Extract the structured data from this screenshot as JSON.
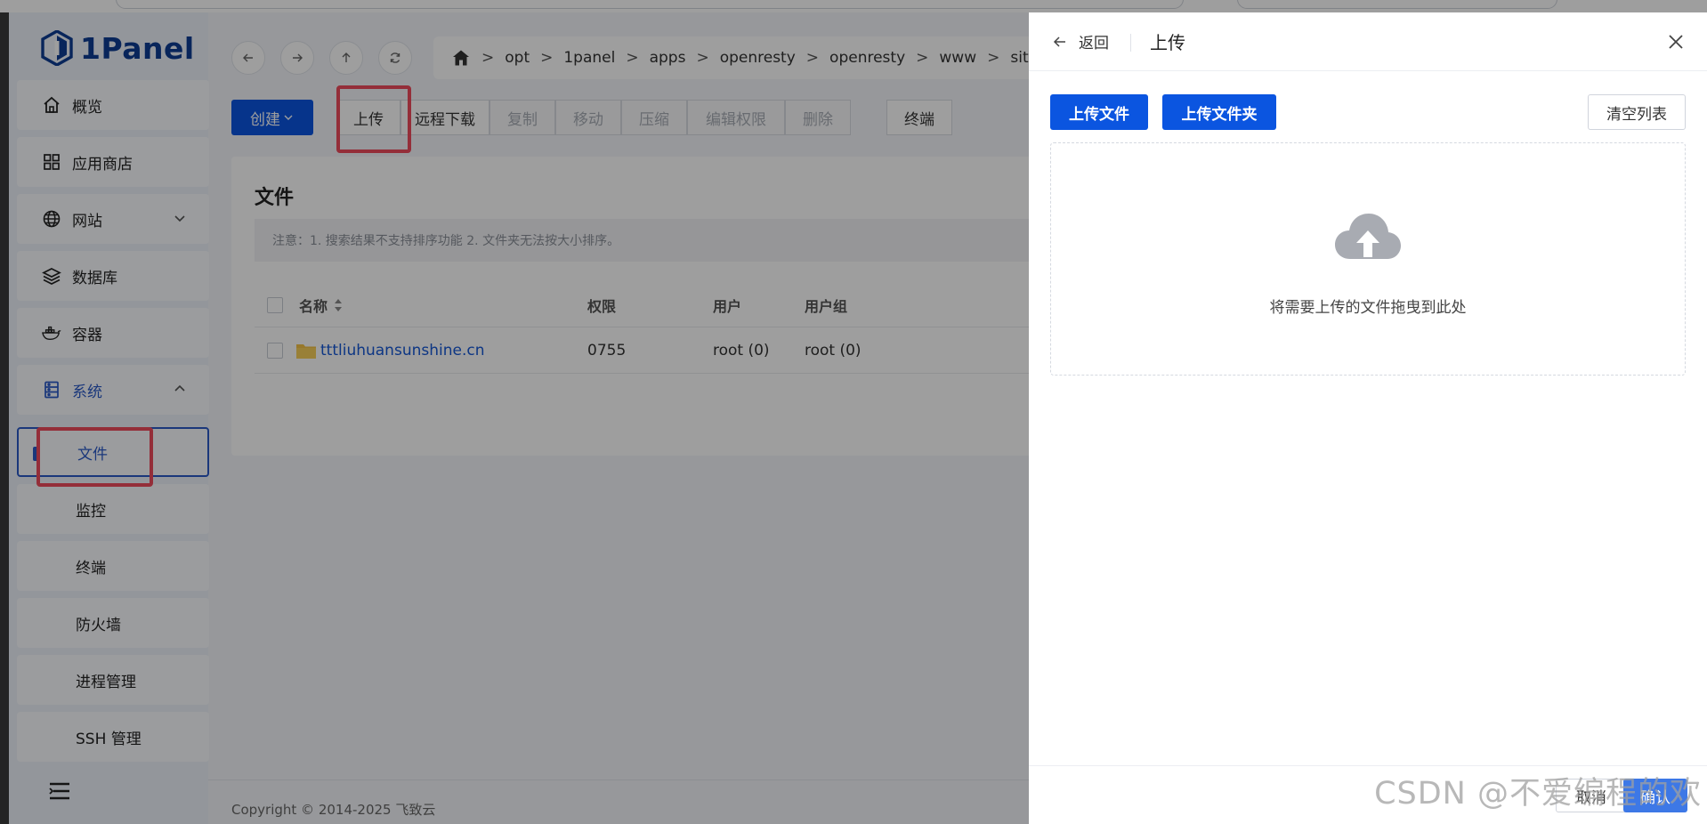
{
  "brand": {
    "name": "1Panel"
  },
  "sidebar": {
    "items": [
      {
        "label": "概览",
        "icon": "home-icon"
      },
      {
        "label": "应用商店",
        "icon": "grid-icon"
      },
      {
        "label": "网站",
        "icon": "globe-icon"
      },
      {
        "label": "数据库",
        "icon": "layers-icon"
      },
      {
        "label": "容器",
        "icon": "docker-icon"
      },
      {
        "label": "系统",
        "icon": "server-icon"
      }
    ],
    "sub_items": [
      {
        "label": "文件",
        "selected": true
      },
      {
        "label": "监控"
      },
      {
        "label": "终端"
      },
      {
        "label": "防火墙"
      },
      {
        "label": "进程管理"
      },
      {
        "label": "SSH 管理"
      }
    ]
  },
  "path": {
    "segments": [
      "opt",
      "1panel",
      "apps",
      "openresty",
      "openresty",
      "www",
      "sites"
    ],
    "separator": ">"
  },
  "toolbar": {
    "create_label": "创建",
    "upload_label": "上传",
    "remote_download_label": "远程下载",
    "copy_label": "复制",
    "move_label": "移动",
    "compress_label": "压缩",
    "permissions_label": "编辑权限",
    "delete_label": "删除",
    "terminal_label": "终端"
  },
  "files": {
    "title": "文件",
    "note": "注意：1. 搜索结果不支持排序功能 2. 文件夹无法按大小排序。",
    "columns": {
      "name": "名称",
      "permission": "权限",
      "user": "用户",
      "group": "用户组"
    },
    "rows": [
      {
        "name": "tttliuhuansunshine.cn",
        "permission": "0755",
        "user": "root (0)",
        "group": "root (0)"
      }
    ]
  },
  "footer": {
    "copyright": "Copyright © 2014-2025 飞致云"
  },
  "drawer": {
    "back_label": "返回",
    "title": "上传",
    "upload_file_label": "上传文件",
    "upload_folder_label": "上传文件夹",
    "clear_list_label": "清空列表",
    "drop_text": "将需要上传的文件拖曳到此处",
    "cancel_label": "取消",
    "confirm_label": "确认"
  },
  "watermark": {
    "text": "CSDN @不爱编程的欢"
  },
  "colors": {
    "primary": "#0b55e0",
    "highlight": "#ef4b5c",
    "brand": "#0e3d93"
  }
}
